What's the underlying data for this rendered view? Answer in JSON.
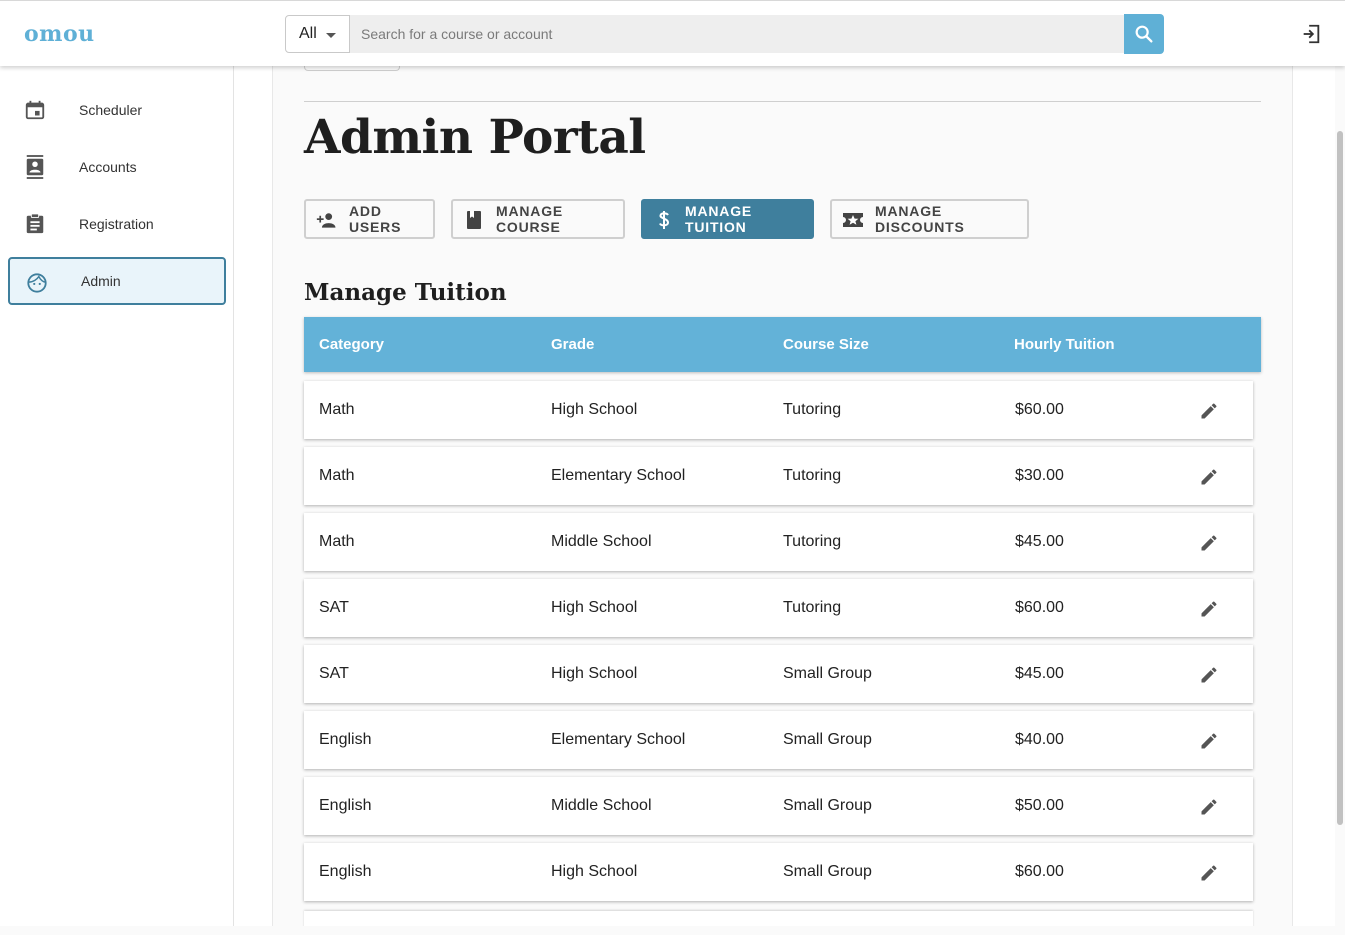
{
  "app": {
    "logo": "omou"
  },
  "search": {
    "filter_value": "All",
    "placeholder": "Search for a course or account"
  },
  "sidebar": {
    "items": [
      {
        "label": "Scheduler",
        "icon": "calendar-icon"
      },
      {
        "label": "Accounts",
        "icon": "contacts-icon"
      },
      {
        "label": "Registration",
        "icon": "clipboard-icon"
      },
      {
        "label": "Admin",
        "icon": "face-icon",
        "active": true
      }
    ]
  },
  "page": {
    "title": "Admin Portal",
    "tabs": [
      {
        "label": "ADD USERS",
        "icon": "person-add-icon"
      },
      {
        "label": "MANAGE COURSE",
        "icon": "book-icon"
      },
      {
        "label": "MANAGE TUITION",
        "icon": "dollar-icon",
        "active": true
      },
      {
        "label": "MANAGE DISCOUNTS",
        "icon": "ticket-star-icon"
      }
    ],
    "section_title": "Manage Tuition"
  },
  "table": {
    "headers": [
      "Category",
      "Grade",
      "Course Size",
      "Hourly Tuition"
    ],
    "rows": [
      {
        "category": "Math",
        "grade": "High School",
        "size": "Tutoring",
        "tuition": "$60.00"
      },
      {
        "category": "Math",
        "grade": "Elementary School",
        "size": "Tutoring",
        "tuition": "$30.00"
      },
      {
        "category": "Math",
        "grade": "Middle School",
        "size": "Tutoring",
        "tuition": "$45.00"
      },
      {
        "category": "SAT",
        "grade": "High School",
        "size": "Tutoring",
        "tuition": "$60.00"
      },
      {
        "category": "SAT",
        "grade": "High School",
        "size": "Small Group",
        "tuition": "$45.00"
      },
      {
        "category": "English",
        "grade": "Elementary School",
        "size": "Small Group",
        "tuition": "$40.00"
      },
      {
        "category": "English",
        "grade": "Middle School",
        "size": "Small Group",
        "tuition": "$50.00"
      },
      {
        "category": "English",
        "grade": "High School",
        "size": "Small Group",
        "tuition": "$60.00"
      }
    ]
  },
  "colors": {
    "accent": "#5fb0d6",
    "header": "#63b2d8",
    "active_tab": "#3f7f9d"
  }
}
